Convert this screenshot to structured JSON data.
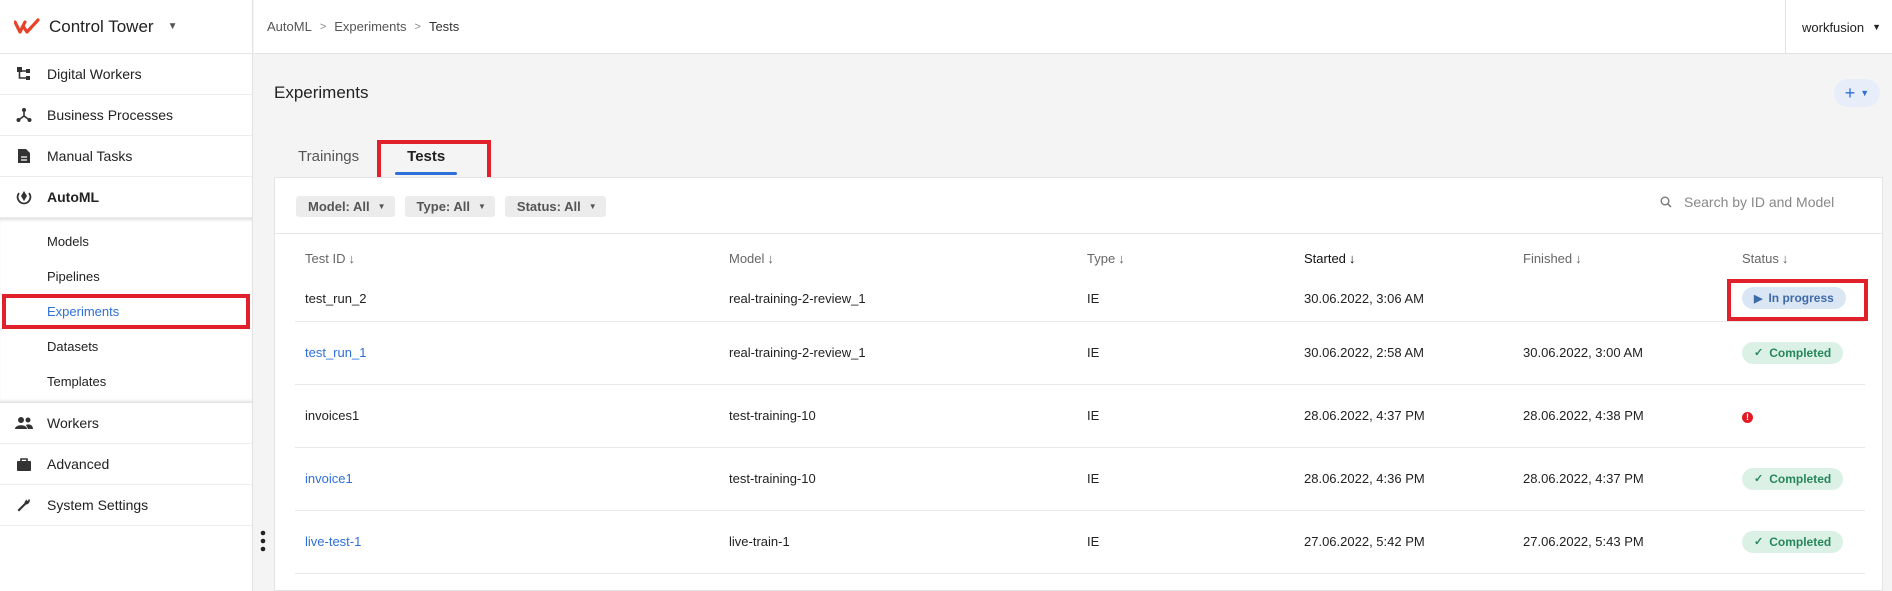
{
  "app": {
    "name": "Control Tower",
    "logo_color": "#e8432a"
  },
  "sidebar": {
    "items": [
      {
        "label": "Digital Workers",
        "icon": "hierarchy-icon"
      },
      {
        "label": "Business Processes",
        "icon": "process-icon"
      },
      {
        "label": "Manual Tasks",
        "icon": "document-icon"
      },
      {
        "label": "AutoML",
        "icon": "automl-icon"
      }
    ],
    "sub_items": [
      {
        "label": "Models"
      },
      {
        "label": "Pipelines"
      },
      {
        "label": "Experiments",
        "active": true
      },
      {
        "label": "Datasets"
      },
      {
        "label": "Templates"
      }
    ],
    "bottom_items": [
      {
        "label": "Workers",
        "icon": "people-icon"
      },
      {
        "label": "Advanced",
        "icon": "briefcase-icon"
      },
      {
        "label": "System Settings",
        "icon": "wrench-icon"
      }
    ]
  },
  "breadcrumb": {
    "items": [
      "AutoML",
      "Experiments"
    ],
    "current": "Tests"
  },
  "user": {
    "name": "workfusion"
  },
  "page": {
    "title": "Experiments",
    "add_label": "+"
  },
  "tabs": [
    {
      "label": "Trainings"
    },
    {
      "label": "Tests",
      "active": true
    }
  ],
  "filters": [
    {
      "label": "Model: All"
    },
    {
      "label": "Type: All"
    },
    {
      "label": "Status: All"
    }
  ],
  "search": {
    "placeholder": "Search by ID and Model"
  },
  "table": {
    "columns": [
      "Test ID",
      "Model",
      "Type",
      "Started",
      "Finished",
      "Status"
    ],
    "rows": [
      {
        "id": "test_run_2",
        "link": false,
        "model": "real-training-2-review_1",
        "type": "IE",
        "started": "30.06.2022, 3:06 AM",
        "finished": "",
        "status": "In progress"
      },
      {
        "id": "test_run_1",
        "link": true,
        "model": "real-training-2-review_1",
        "type": "IE",
        "started": "30.06.2022, 2:58 AM",
        "finished": "30.06.2022, 3:00 AM",
        "status": "Completed"
      },
      {
        "id": "invoices1",
        "link": false,
        "model": "test-training-10",
        "type": "IE",
        "started": "28.06.2022, 4:37 PM",
        "finished": "28.06.2022, 4:38 PM",
        "status": "error"
      },
      {
        "id": "invoice1",
        "link": true,
        "model": "test-training-10",
        "type": "IE",
        "started": "28.06.2022, 4:36 PM",
        "finished": "28.06.2022, 4:37 PM",
        "status": "Completed"
      },
      {
        "id": "live-test-1",
        "link": true,
        "model": "live-train-1",
        "type": "IE",
        "started": "27.06.2022, 5:42 PM",
        "finished": "27.06.2022, 5:43 PM",
        "status": "Completed"
      }
    ]
  },
  "colors": {
    "accent": "#2e6fd8",
    "highlight": "#e0202a",
    "success": "#27875a",
    "error": "#e01b24"
  }
}
